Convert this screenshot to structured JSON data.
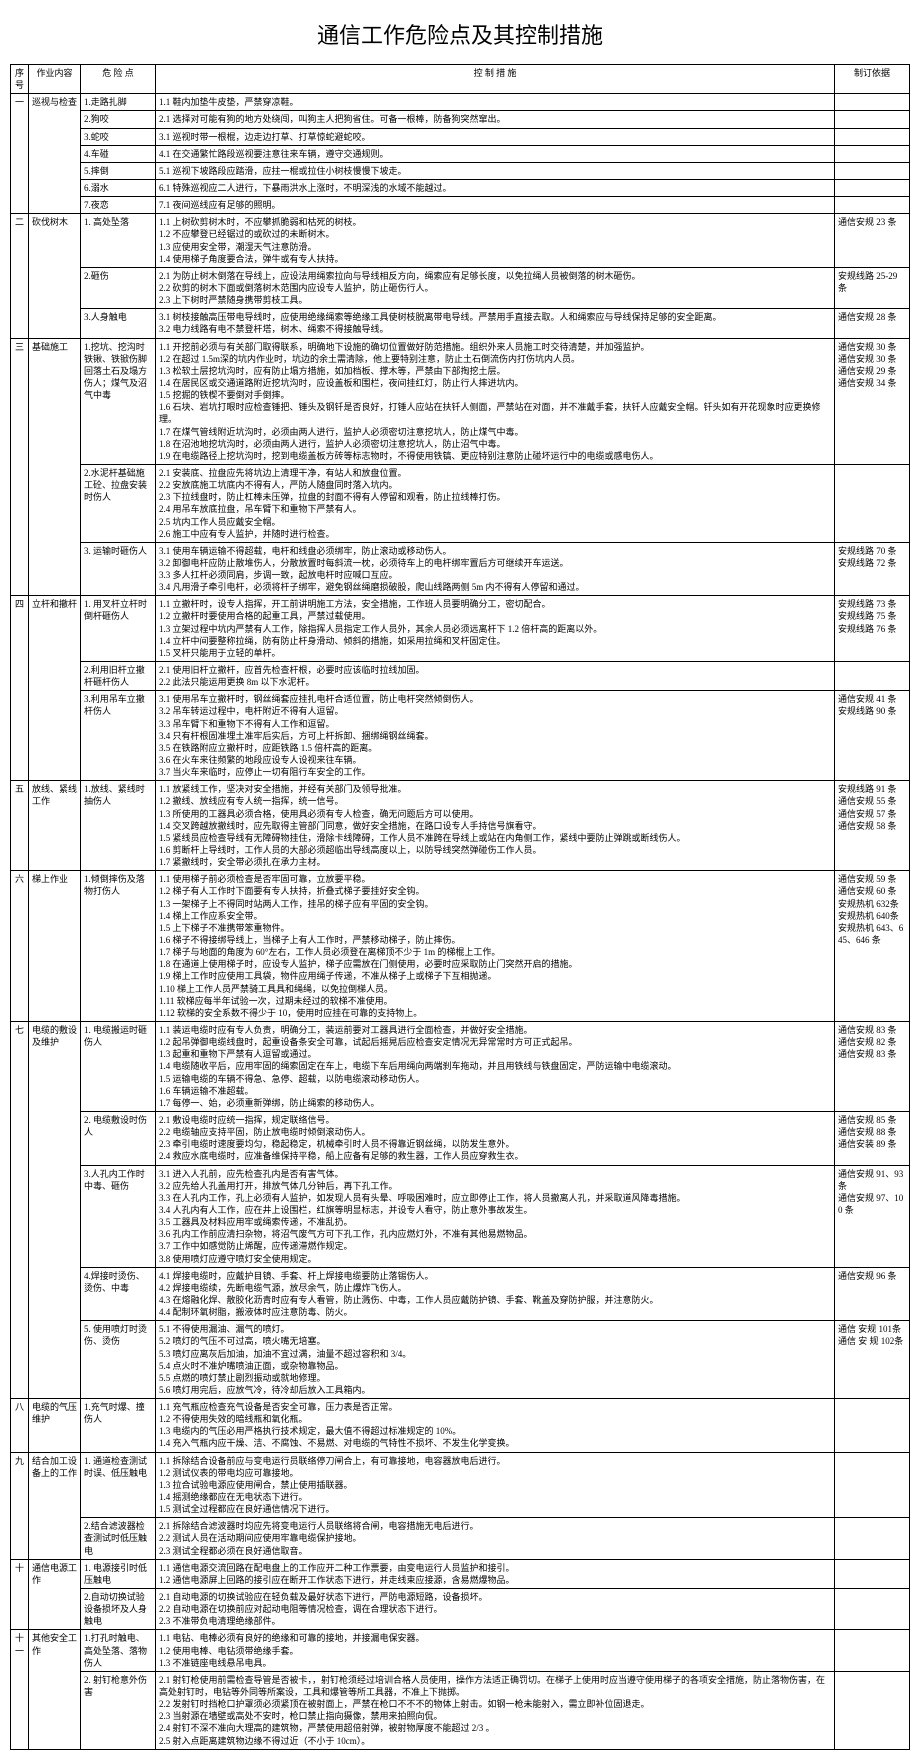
{
  "title": "通信工作危险点及其控制措施",
  "headers": {
    "seq": "序号",
    "work": "作业内容",
    "risk": "危 险 点",
    "measure": "控    制    措    施",
    "basis": "制订依据"
  },
  "sections": [
    {
      "seq": "一",
      "work": "巡视与检查",
      "risks": [
        {
          "risk": "1.走路扎脚",
          "measures": [
            "1.1 鞋内加垫牛皮垫，严禁穿凉鞋。"
          ],
          "basis": ""
        },
        {
          "risk": "2.狗咬",
          "measures": [
            "2.1 选择对可能有狗的地方处绕闯，叫狗主人把狗省住。可备一根棒，防备狗突然窜出。"
          ],
          "basis": ""
        },
        {
          "risk": "3.蛇咬",
          "measures": [
            "3.1 巡视时带一根棍，边走边打草、打草惊蛇避蛇咬。"
          ],
          "basis": ""
        },
        {
          "risk": "4.车碰",
          "measures": [
            "4.1 在交通繁忙路段巡视要注意往来车辆，遵守交通规则。"
          ],
          "basis": ""
        },
        {
          "risk": "5.摔倒",
          "measures": [
            "5.1 巡视下坡路段应踏滑，应拄一棍或拉住小树枝慢慢下坡走。"
          ],
          "basis": ""
        },
        {
          "risk": "6.溺水",
          "measures": [
            "6.1 特殊巡视应二人进行，下暴雨洪水上涨时，不明深浅的水域不能越过。"
          ],
          "basis": ""
        },
        {
          "risk": "7.夜恋",
          "measures": [
            "7.1 夜间巡线应有足够的照明。"
          ],
          "basis": ""
        }
      ]
    },
    {
      "seq": "二",
      "work": "砍伐树木",
      "risks": [
        {
          "risk": "1. 高处坠落",
          "measures": [
            "1.1 上树砍剪树木时，不应攀抓脆弱和枯死的树枝。",
            "1.2 不应攀登已经锯过的或砍过的未断树木。",
            "1.3 应使用安全带，潮湿天气注意防滑。",
            "1.4 使用梯子角度要合法，弹牛或有专人扶持。"
          ],
          "basis": "通信安规 23 条"
        },
        {
          "risk": "2.砸伤",
          "measures": [
            "2.1 为防止树木倒落在导线上，应设法用绳索拉向与导线相反方向，绳索应有足够长度，以免拉绳人员被倒落的树木砸伤。",
            "2.2 砍剪的树木下面或倒落树木范围内应设专人监护，防止砸伤行人。",
            "2.3 上下树时严禁随身携带剪枝工具。"
          ],
          "basis": "安规线路 25-29条"
        },
        {
          "risk": "3.人身触电",
          "measures": [
            "3.1 树枝接触高压带电导线时，应使用绝缘绳索等绝缘工具使树枝脱离带电导线。严禁用手直接去取。人和绳索应与导线保持足够的安全距离。",
            "3.2 电力线路有电不禁登杆塔，树木、绳索不得接触导线。"
          ],
          "basis": "通信安规 28 条"
        }
      ]
    },
    {
      "seq": "三",
      "work": "基础施工",
      "risks": [
        {
          "risk": "1.挖坑、挖沟时铁锹、铁锨伤脚 回落土石及塌方伤人；煤气及沼气中毒",
          "measures": [
            "1.1 开挖前必须与有关部门取得联系，明确地下设施的确切位置做好防范措施。组织外来人员施工时交待清楚，并加强监护。",
            "1.2 在超过 1.5m深的坑内作业时，坑边的余土需清除，他上要特别注意，防止土石倒流伤内打伤坑内人员。",
            "1.3 松软土层挖坑沟时，应有防止塌方措施，如加档板、撑木等，严禁由下部掏挖土层。",
            "1.4 在居民区或交通道路附近挖坑沟时，应设盖板和围栏，夜间挂红灯，防止行人摔进坑内。",
            "1.5 挖掘的铁楔不要倒对手倒摔。",
            "1.6 石块、岩坑打眼时应检查锤把、锤头及钢钎是否良好，打锤人应站在扶钎人侧面，严禁站在对面，并不准戴手套，扶钎人应戴安全帽。钎头如有开花现象时应更换修理。",
            "1.7 在煤气管线附近坑沟时，必须由两人进行，监护人必须密切注意挖坑人，防止煤气中毒。",
            "1.8 在沼池地挖坑沟时，必须由两人进行，监护人必须密切注意挖坑人，防止沼气中毒。",
            "1.9 在电缆路径上挖坑沟时，挖到电缆盖板方砖等标志物时，不得使用铁镐、更应特别注意防止碰坏运行中的电缆或感电伤人。"
          ],
          "basis": "通信安规 30 条\n通信安规 30 条\n通信安规 29 条\n通信安规 34 条"
        },
        {
          "risk": "2.水泥杆基础施工砼、拉盘安装时伤人",
          "measures": [
            "2.1 安装底、拉盘应先将坑边上清理干净，有站人和放盘位置。",
            "2.2 安放底施工坑底内不得有人，严防人随盘同时落入坑内。",
            "2.3 下拉线盘时，防止杠棒未压弹，拉盘的封面不得有人停留和观看，防止拉线棒打伤。",
            "2.4 用吊车放底拉盘，吊车臂下和重物下严禁有人。",
            "2.5 坑内工作人员应戴安全帽。",
            "2.6 施工中应有专人监护，并随时进行检查。"
          ],
          "basis": ""
        },
        {
          "risk": "3. 运输时砸伤人",
          "measures": [
            "3.1 使用车辆运输不得超载，电杆和线盘必须绑牢，防止滚动或移动伤人。",
            "3.2 卸御电杆应防止散堆伤人，分散放置时每斜流一枕，必须待车上的电杆绑牢置后方可继续开车运送。",
            "3.3 多人扛杆必须同肩，步调一致，起放电杆时应喊口互应。",
            "3.4 凡用滑子牵引电杆，必须将杆子绑牢，避免钢丝绳磨损破股，爬山线路两侧 5m 内不得有人停留和通过。"
          ],
          "basis": "安规线路 70 条\n安规线路 72 条"
        }
      ]
    },
    {
      "seq": "四",
      "work": "立杆和撤杆",
      "risks": [
        {
          "risk": "1. 用叉杆立杆时倒杆砸伤人",
          "measures": [
            "1.1 立撤杆时，设专人指挥，开工前讲明施工方法，安全措施，工作班人员要明确分工，密切配合。",
            "1.2 立撤杆时要使用合格的起重工具，严禁过载使用。",
            "1.3 立架过程中坑内严禁有人工作，除指挥人员指定工作人员外，其余人员必须远离杆下 1.2 倍杆高的距离以外。",
            "1.4 立杆中间要整称拉绳，防有防止杆身滑动、倾斜的措施，如采用拉绳和叉杆固定住。",
            "1.5 叉杆只能用于立轻的单杆。"
          ],
          "basis": "安规线路 73 条\n安规线路 75 条\n安规线路 76 条"
        },
        {
          "risk": "2.利用旧杆立撤杆砸杆伤人",
          "measures": [
            "2.1 使用旧杆立撤杆，应首先检查杆根，必要时应该临时拉线加固。",
            "2.2 此法只能运用更换 8m 以下水泥杆。"
          ],
          "basis": ""
        },
        {
          "risk": "3.利用吊车立撤杆伤人",
          "measures": [
            "3.1 使用吊车立撤杆时，钢丝绳套应挂扎电杆合适位置，防止电杆突然倾倒伤人。",
            "3.2 吊车转运过程中，电杆附近不得有人逗留。",
            "3.3 吊车臂下和重物下不得有人工作和逗留。",
            "3.4 只有杆根固准埋土准牢后实后，方可上杆拆卸、捆绑绳钢丝绳套。",
            "3.5 在铁路附应立撤杆时，应距铁路 1.5 倍杆高的距离。",
            "3.6 在火车来往频繁的地段应设专人设视来往车辆。",
            "3.7 当火车来临时，应停止一切有阻行车安全的工作。"
          ],
          "basis": "通信安规 41 条\n安规线路 90 条"
        }
      ]
    },
    {
      "seq": "五",
      "work": "放线、紧线工作",
      "risks": [
        {
          "risk": "1.放线、紧线时抽伤人",
          "measures": [
            "1.1 放紧线工作，坚决对安全措施，并经有关部门及领导批准。",
            "1.2 撤线、放线应有专人统一指挥，统一信号。",
            "1.3 所使用的工器具必须合格，使用具必须有专人检查，确无问题后方可以使用。",
            "1.4 交叉跨越放撤线时，应先取得主管部门同意，做好安全措施，在路口设专人手持信号旗看守。",
            "1.5 紧线员应检查导线有无障碍物挂住，滑除卡线障碍，工作人员不准跨在导线上或站在内角侧工作，紧线中要防止弹跳或断线伤人。",
            "1.6 剪断杆上导线时，工作人员的大部必须超临出导线高度以上，以防导线突然弹碰伤工作人员。",
            "1.7 紧撤线时，安全带必须扎在承力主材。"
          ],
          "basis": "安规线路 91 条\n通信安规 55 条\n通信安规 57 条\n通信安规 58 条"
        }
      ]
    },
    {
      "seq": "六",
      "work": "梯上作业",
      "risks": [
        {
          "risk": "1.倾倒摔伤及落物打伤人",
          "measures": [
            "1.1 使用梯子前必须检查是否牢固可靠，立放要平稳。",
            "1.2 梯子有人工作时下面要有专人扶持，折叠式梯子要挂好安全钩。",
            "1.3 一架梯子上不得同时站两人工作，挂吊的梯子应有平固的安全钩。",
            "1.4 梯上工作应系安全带。",
            "1.5 上下梯子不准携带笨重物件。",
            "1.6 梯子不得接绑导线上，当梯子上有人工作时，严禁移动梯子，防止摔伤。",
            "1.7 梯子与地面的角度为 60°左右，工作人员必须登在离梯顶不少于 1m 的梯棍上工作。",
            "1.8 在通道上使用梯子时，应设专人监护，梯子应需放在门侧使用，必要时应采取防止门突然开启的措施。",
            "1.9 梯上工作时应使用工具袋，物件应用绳子传递，不准从梯子上或梯子下互相抛递。",
            "1.10 梯上工作人员严禁骑工具具和绳绳，以免拉倒梯人员。",
            "1.11 软梯应每半年试验一次，过期未经过的软梯不准使用。",
            "1.12 软梯的安全系数不得少于 10，使用时应挂在可靠的支持物上。"
          ],
          "basis": "通信安规 59 条\n通信安规 60 条\n安规热机 632条\n安规热机 640条\n安规热机 643、645、646 条"
        }
      ]
    },
    {
      "seq": "七",
      "work": "电缆的敷设及维护",
      "risks": [
        {
          "risk": "1. 电缆搬运时砸伤人",
          "measures": [
            "1.1 装运电缆时应有专人负责，明确分工，装运前要对工器具进行全面检查，并做好安全措施。",
            "1.2 起吊弹御电缆线盘时，起重设备条安全可靠，试起后摇晃后应检查安定情况无异常常时方可正式起吊。",
            "1.3 起重和重物下严禁有人逗留或通过。",
            "1.4 电缆随收平后，应用牢固的绳索固定在车上，电缆下车后用绳向两端刹车拖动，并且用铁线与铁盘固定，严防运输中电缆滚动。",
            "1.5 运输电缆的车辆不得急、急停、超载，以防电缆滚动移动伤人。",
            "1.6 车辆运输不准超载。",
            "1.7 每停一、始，必须重新弹绑，防止绳索的移动伤人。"
          ],
          "basis": "通信安规 83 条\n通信安规 82 条\n通信安规 83 条"
        },
        {
          "risk": "2. 电缆敷设时伤人",
          "measures": [
            "2.1 敷设电缆时应统一指挥，规定联络信号。",
            "2.2 电缆轴应支持平固，防止放电缆时倾倒滚动伤人。",
            "2.3 牵引电缆时速度要均匀，稳起稳定，机械牵引时人员不得靠近钢丝绳，以防发生意外。",
            "2.4 救应水底电缆时，应准备维保持平稳，船上应备有足够的救生器，工作人员应穿救生衣。"
          ],
          "basis": "通信安规 85 条\n通信安规 88 条\n通信安装 89 条"
        },
        {
          "risk": "3.人孔内工作时中毒、砸伤",
          "measures": [
            "3.1 进入人孔前，应先检查孔内是否有害气体。",
            "3.2 应先给人孔盖用打开，排放气体几分钟后，再下孔工作。",
            "3.3 在人孔内工作，孔上必须有人监护，如发现人员有头晕、呼吸困难时，应立即停止工作，将人员撤离人孔，并采取道风降毒措施。",
            "3.4 人孔内有人工作，应在井上设围栏，红旗等明显标志，并设专人看守，防止意外事故发生。",
            "3.5 工器具及材料应用牢或绳索传递，不准乱扔。",
            "3.6 孔内工作前应清扫杂物，将沼气废气方可下孔工作，孔内应燃灯外，不准有其他易燃物品。",
            "3.7 工作中如感觉防止烯醒，应传递滞燃作规定。",
            "3.8 使用喷灯应遵守喷灯安全使用规定。"
          ],
          "basis": "通信安规 91、93 条\n通信安规 97、100 条"
        },
        {
          "risk": "4.焊接时烫伤、烫伤、中毒",
          "measures": [
            "4.1 焊接电缆时，应戴护目镜、手套、杆上焊接电缆要防止落锡伤人。",
            "4.2 焊接电缆续，先断电缆气源，放尽余气，防止爆炸飞伤人。",
            "4.3 在熔融化焊、散胶化沥青时应有专人看管，防止溅伤、中毒，工作人员应戴防护镜、手套、靴盖及穿防护服，并注意防火。",
            "4.4 配制环氧树脂，搬液体时应注意防毒、防火。"
          ],
          "basis": "通信安规 96 条"
        },
        {
          "risk": "5. 使用喷灯时烫伤、烫伤",
          "measures": [
            "5.1 不得使用漏油、漏气的喷灯。",
            "5.2 喷灯的气压不可过高，喷火嘴无培塞。",
            "5.3 喷灯应离灰后加油，加油不宜过满，油量不超过容积和 3/4。",
            "5.4 点火时不准炉嘴喷油正面，或杂物靠物品。",
            "5.5 点燃的喷灯禁止剧烈振动或就地修理。",
            "5.6 喷灯用完后，应放气冷，待冷却后放入工具箱内。"
          ],
          "basis": "通信 安规 101条\n通信 安 规 102条"
        }
      ]
    },
    {
      "seq": "八",
      "work": "电缆的气压维护",
      "risks": [
        {
          "risk": "1.充气时爆、撞伤人",
          "measures": [
            "1.1 充气瓶应检查充气设备是否安全可靠，压力表是否正常。",
            "1.2 不得使用失效的暗线瓶和氧化瓶。",
            "1.3 电缆内的气压必用严格执行技术规定，最大值不得超过标准规定的 10%。",
            "1.4 充入气瓶内应干燥、洁、不腐蚀、不易燃、对电缆的气特性不损坏、不发生化学变换。"
          ],
          "basis": ""
        }
      ]
    },
    {
      "seq": "九",
      "work": "结合加工设备上的工作",
      "risks": [
        {
          "risk": "1. 通道检查测试时误、低压触电",
          "measures": [
            "1.1 拆除结合设备前应与变电运行员联络停刀闸合上，有可靠接地，电容器放电后进行。",
            "1.2 测试仪表的带电均应可靠接地。",
            "1.3 拉合试验电源应使用闸合，禁止使用插联器。",
            "1.4 摇测绝缘都应在无电状态下进行。",
            "1.5 测试全过程都应在良好通信情况下进行。"
          ],
          "basis": ""
        },
        {
          "risk": "2.结合滤波器检查测试时低压触电",
          "measures": [
            "2.1 拆除结合滤波器时均应先将变电运行人员联络将合闸，电容措施无电后进行。",
            "2.2 测试人员在活动期间应使用牢靠电缆保护接地。",
            "2.3 测试全程都必须在良好通信取音。"
          ],
          "basis": ""
        }
      ]
    },
    {
      "seq": "十",
      "work": "通信电源工作",
      "risks": [
        {
          "risk": "1. 电源接引时低压触电",
          "measures": [
            "1.1 通信电源交流回路在配电盘上的工作应开二种工作票要，由变电运行人员监护和接引。",
            "1.2 通信电源屏上回路的接引应在断开工作状态下进行，并走线束应接源，含易燃爆物品。"
          ],
          "basis": ""
        },
        {
          "risk": "2.自动切换试验 设备损坏及人身触电",
          "measures": [
            "2.1 自动电源的切换试验应在轻负载及最好状态下进行，严防电源短路，设备损坏。",
            "2.2 自动电源在切换前应对起动电阻等情况检查，调在合理状态下进行。",
            "2.3 不准带负电清理绝缘部件。"
          ],
          "basis": ""
        }
      ]
    },
    {
      "seq": "十一",
      "work": "其他安全工作",
      "risks": [
        {
          "risk": "1.打孔时触电、高处坠落、落物伤人",
          "measures": [
            "1.1 电钻、电棒必须有良好的绝缘和可靠的接地，并接漏电保安器。",
            "1.2 使用电棒、电钻须带绝缘手套。",
            "1.3 不准链座电线悬吊电具。"
          ],
          "basis": ""
        },
        {
          "risk": "2. 射钉枪意外伤害",
          "measures": [
            "2.1 射钉枪使用前需检查导管是否被卡，，射钉枪须经过培训合格人员使用，操作方法适正确罚切。在梯子上使用时应当遵守使用梯子的各项安全措施，防止落物伤害，在高处射钉时，电钻等外同等所案设，工具和爆管等所工具器，不准上下抛掷。",
            "2.2 发射钉时挡枪口护罩须必须紧顶在被射面上，严禁在枪口不不不的物体上射击。如钢一枪未能射入，需立即补位固退走。",
            "2.3 当射源在墙壁或高处不安时，枪口禁止指向摄像，禁用来拍照向侃。",
            "2.4 射钉不深不准向大理高的建筑物，严禁使用超倍射弹，被射物厚度不能超过 2/3 。",
            "2.5 射入点距离建筑物边缘不得过近（不小于 10cm）。"
          ],
          "basis": ""
        }
      ]
    }
  ]
}
